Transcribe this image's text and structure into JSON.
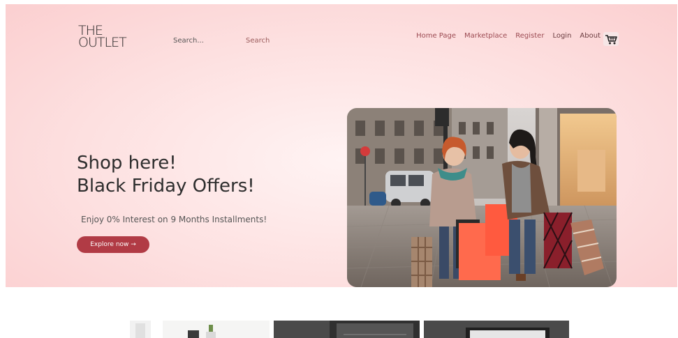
{
  "header": {
    "logo_line1": "THE",
    "logo_line2": "OUTLET",
    "search_placeholder": "Search...",
    "search_button": "Search",
    "nav": [
      "Home Page",
      "Marketplace",
      "Register",
      "Login",
      "About"
    ],
    "cart_icon": "cart-icon"
  },
  "hero": {
    "headline_line1": "Shop here!",
    "headline_line2": "Black Friday Offers!",
    "subline": "Enjoy 0% Interest on 9 Months Installments!",
    "cta_label": "Explore now →",
    "image": "two women carrying shopping bags on a city street"
  },
  "colors": {
    "accent": "#b13b45",
    "nav_link": "#9b4a52",
    "hero_bg": "#fde0e0"
  }
}
